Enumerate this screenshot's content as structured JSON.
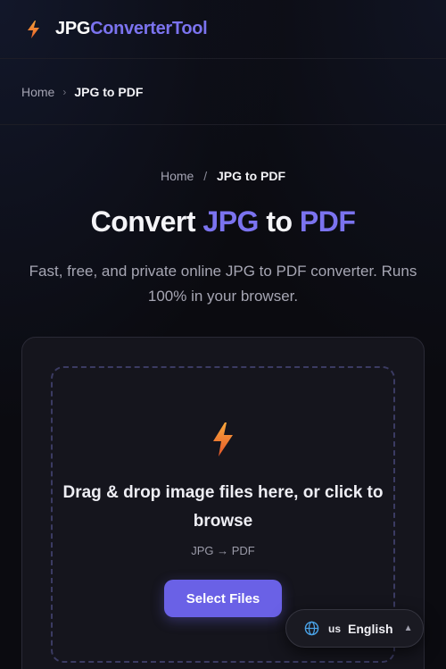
{
  "header": {
    "brand_part1": "JPG",
    "brand_part2": "ConverterTool",
    "logo_icon": "lightning-bolt-icon",
    "accent_color": "#7b73ef"
  },
  "breadcrumb_bar": {
    "home": "Home",
    "separator": "›",
    "current": "JPG to PDF"
  },
  "hero": {
    "breadcrumb_home": "Home",
    "breadcrumb_separator": "/",
    "breadcrumb_current": "JPG to PDF",
    "title_word1": "Convert",
    "title_from": "JPG",
    "title_word2": "to",
    "title_to": "PDF",
    "subtitle": "Fast, free, and private online JPG to PDF converter. Runs 100% in your browser."
  },
  "upload": {
    "icon": "lightning-bolt-icon",
    "instruction": "Drag & drop image files here, or click to browse",
    "hint": "JPG → PDF",
    "button_label": "Select Files",
    "button_color": "#6a61e6"
  },
  "language": {
    "icon": "globe-icon",
    "code": "us",
    "label": "English",
    "caret": "▲"
  }
}
